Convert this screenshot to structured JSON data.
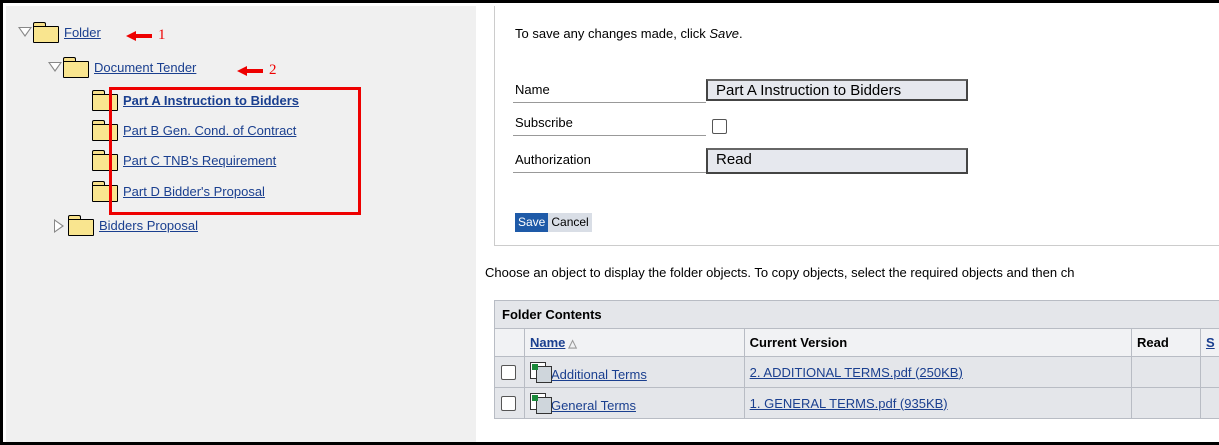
{
  "tree": {
    "items": [
      {
        "label": "Folder",
        "bold": false,
        "expanded": true
      },
      {
        "label": "Document Tender",
        "bold": false,
        "expanded": true
      },
      {
        "label": "Part A Instruction to Bidders",
        "bold": true
      },
      {
        "label": "Part B Gen. Cond. of Contract",
        "bold": false
      },
      {
        "label": "Part C TNB's Requirement",
        "bold": false
      },
      {
        "label": "Part D Bidder's Proposal",
        "bold": false
      },
      {
        "label": "Bidders Proposal",
        "bold": false,
        "expanded": false
      }
    ],
    "annotations": [
      {
        "label": "1"
      },
      {
        "label": "2"
      }
    ]
  },
  "detail": {
    "hint_prefix": "To save any changes made, click ",
    "hint_emph": "Save",
    "hint_suffix": ".",
    "name_label": "Name",
    "name_value": "Part A Instruction to Bidders",
    "subscribe_label": "Subscribe",
    "subscribe_checked": false,
    "authorization_label": "Authorization",
    "authorization_value": "Read",
    "save_label": "Save",
    "cancel_label": "Cancel"
  },
  "choose_text": "Choose an object to display the folder objects. To copy objects, select the required objects and then ch",
  "folder_contents": {
    "caption": "Folder Contents",
    "columns": [
      "Name",
      "Current Version",
      "Read",
      "S"
    ],
    "rows": [
      {
        "name": "Additional Terms",
        "version": "2. ADDITIONAL TERMS.pdf (250KB)"
      },
      {
        "name": "General Terms",
        "version": "1. GENERAL TERMS.pdf (935KB)"
      }
    ]
  },
  "colors": {
    "accent": "#1e5aa8",
    "link": "#1a3f8f",
    "annotation": "#e00000"
  }
}
